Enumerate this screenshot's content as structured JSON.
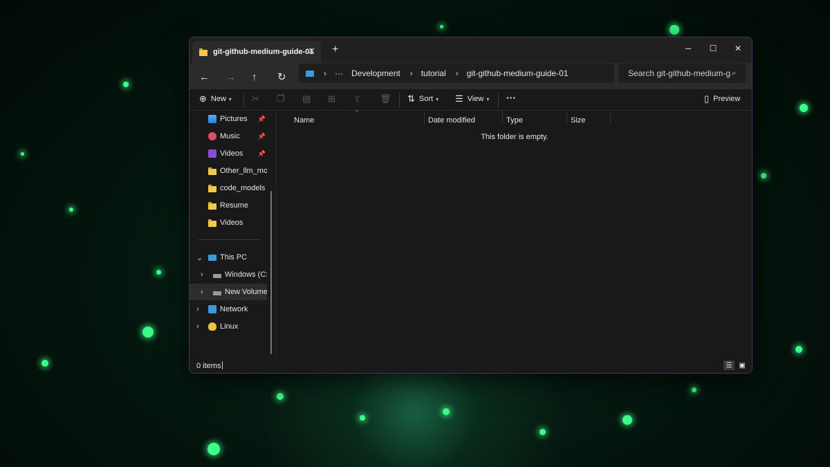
{
  "window": {
    "tab_title": "git-github-medium-guide-01",
    "tab_close": "✕",
    "new_tab": "+",
    "minimize": "─",
    "maximize": "☐",
    "close": "✕"
  },
  "nav": {
    "back": "←",
    "forward": "→",
    "up": "↑",
    "refresh": "↻",
    "breadcrumb": [
      "Development",
      "tutorial",
      "git-github-medium-guide-01"
    ],
    "overflow": "···",
    "search_placeholder": "Search git-github-medium-g"
  },
  "toolbar": {
    "new_label": "New",
    "sort_label": "Sort",
    "view_label": "View",
    "more_label": "···",
    "preview_label": "Preview"
  },
  "sidebar": {
    "quick_access": [
      {
        "label": "Pictures",
        "icon": "pictures-icon",
        "pinned": true
      },
      {
        "label": "Music",
        "icon": "music-icon",
        "pinned": true
      },
      {
        "label": "Videos",
        "icon": "videos-icon",
        "pinned": true
      },
      {
        "label": "Other_llm_models",
        "icon": "folder-icon",
        "pinned": false
      },
      {
        "label": "code_models",
        "icon": "folder-icon",
        "pinned": false
      },
      {
        "label": "Resume",
        "icon": "folder-icon",
        "pinned": false
      },
      {
        "label": "Videos",
        "icon": "folder-icon",
        "pinned": false
      }
    ],
    "this_pc": "This PC",
    "drives": [
      "Windows (C:)",
      "New Volume (D:)"
    ],
    "network": "Network",
    "linux": "Linux"
  },
  "content": {
    "columns": [
      "Name",
      "Date modified",
      "Type",
      "Size"
    ],
    "empty_message": "This folder is empty."
  },
  "status": {
    "item_count": "0 items"
  },
  "colors": {
    "window_border": "#4b2f63",
    "folder": "#f2c94c",
    "accent_star": "#3cff8a"
  }
}
